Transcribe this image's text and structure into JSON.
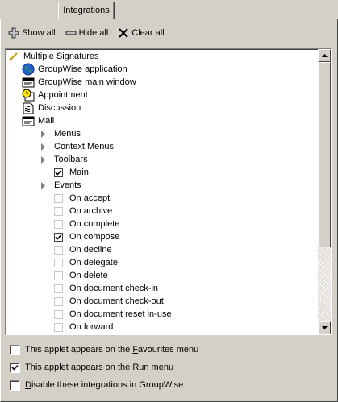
{
  "tabs": [
    {
      "label": "Integrations"
    }
  ],
  "toolbar": {
    "show_all": "Show all",
    "hide_all": "Hide all",
    "clear_all": "Clear all"
  },
  "tree": {
    "root": "Multiple Signatures",
    "items": {
      "groupwise_application": "GroupWise application",
      "groupwise_main_window": "GroupWise main window",
      "appointment": "Appointment",
      "discussion": "Discussion",
      "mail": "Mail",
      "menus": "Menus",
      "context_menus": "Context Menus",
      "toolbars": "Toolbars",
      "main": "Main",
      "events": "Events"
    },
    "events": [
      {
        "label": "On accept",
        "checked": false
      },
      {
        "label": "On archive",
        "checked": false
      },
      {
        "label": "On complete",
        "checked": false
      },
      {
        "label": "On compose",
        "checked": true
      },
      {
        "label": "On decline",
        "checked": false
      },
      {
        "label": "On delegate",
        "checked": false
      },
      {
        "label": "On delete",
        "checked": false
      },
      {
        "label": "On document check-in",
        "checked": false
      },
      {
        "label": "On document check-out",
        "checked": false
      },
      {
        "label": "On document reset in-use",
        "checked": false
      },
      {
        "label": "On forward",
        "checked": false
      }
    ]
  },
  "options": {
    "favourites": {
      "pre": "This applet appears on the ",
      "key": "F",
      "post": "avourites menu",
      "checked": false
    },
    "run": {
      "pre": "This applet appears on the ",
      "key": "R",
      "post": "un menu",
      "checked": true
    },
    "disable": {
      "pre": "",
      "key": "D",
      "post": "isable these integrations in GroupWise",
      "checked": false
    }
  },
  "icons": {
    "pencil": "pencil-icon",
    "globe": "globe-icon",
    "window": "window-icon",
    "appointment": "appointment-icon",
    "discussion": "discussion-icon",
    "mail": "mail-icon"
  }
}
